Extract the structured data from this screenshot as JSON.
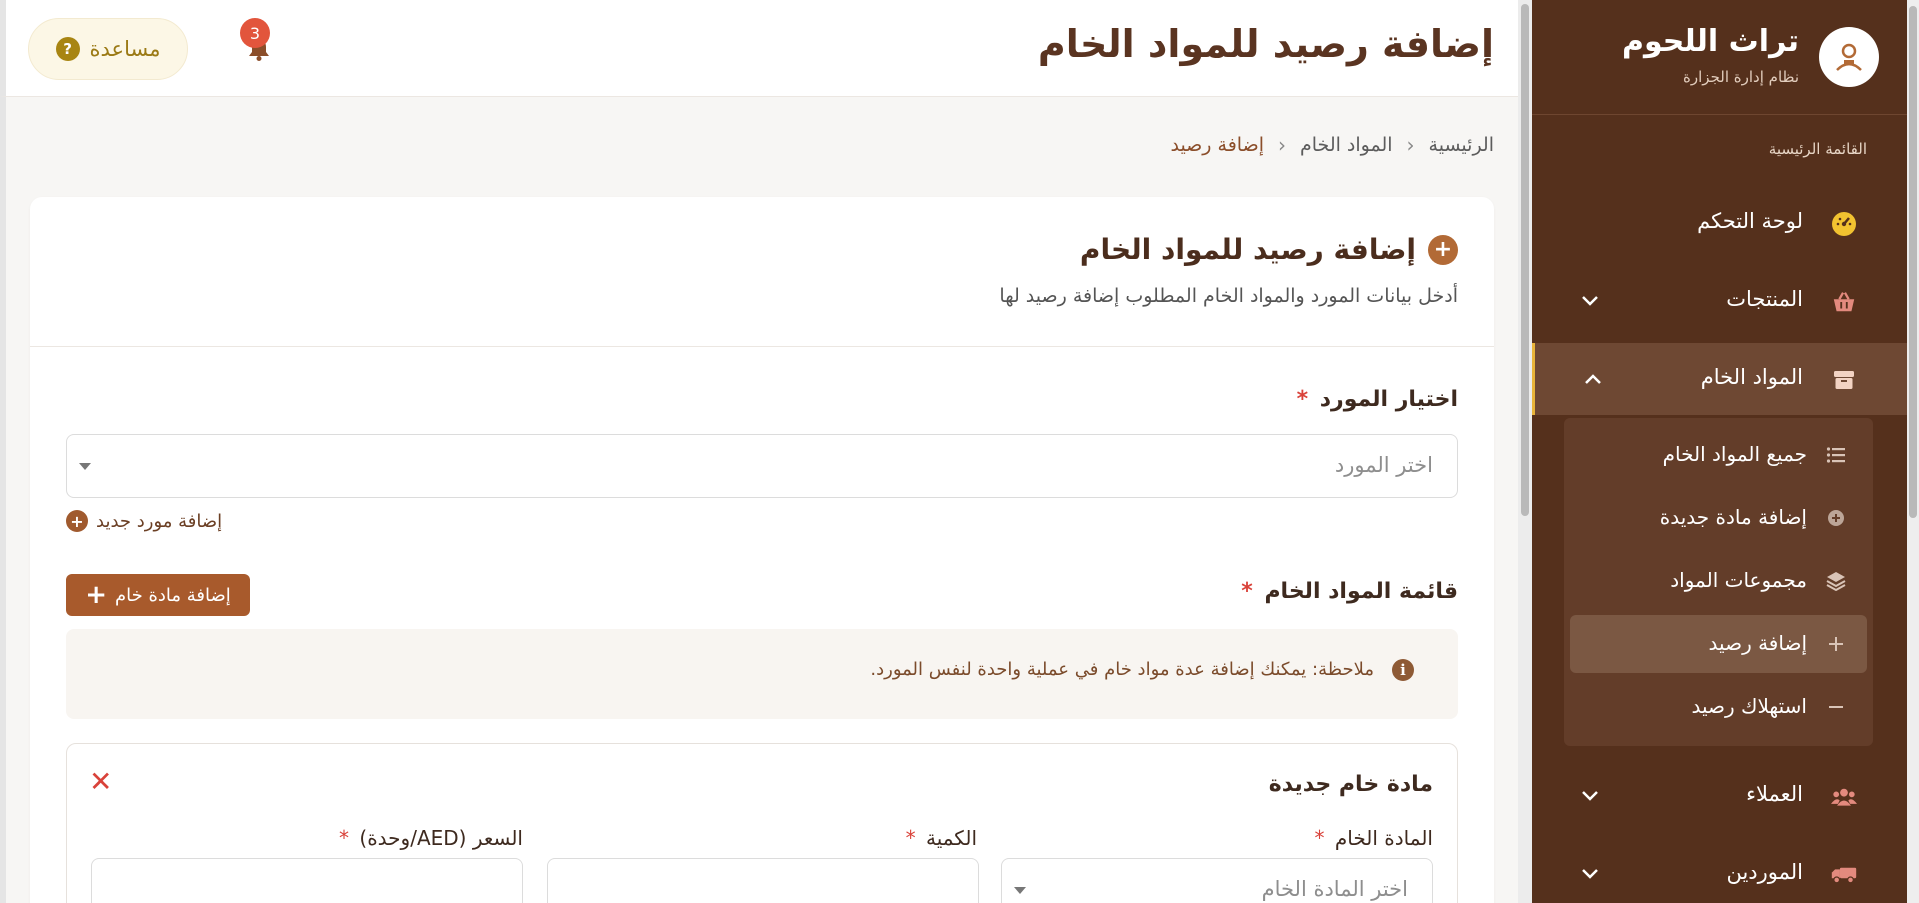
{
  "sidebar": {
    "brand_title": "تراث اللحوم",
    "brand_subtitle": "نظام إدارة الجزارة",
    "section_label": "القائمة الرئيسية",
    "items": [
      {
        "label": "لوحة التحكم",
        "icon": "dashboard-icon"
      },
      {
        "label": "المنتجات",
        "icon": "basket-icon"
      },
      {
        "label": "المواد الخام",
        "icon": "box-icon"
      },
      {
        "label": "العملاء",
        "icon": "users-icon"
      },
      {
        "label": "الموردين",
        "icon": "truck-icon"
      }
    ],
    "submenu": [
      {
        "label": "جميع المواد الخام",
        "icon": "list-icon"
      },
      {
        "label": "إضافة مادة جديدة",
        "icon": "plus-circle-icon"
      },
      {
        "label": "مجموعات المواد",
        "icon": "layers-icon"
      },
      {
        "label": "إضافة رصيد",
        "icon": "plus-icon"
      },
      {
        "label": "استهلاك رصيد",
        "icon": "minus-icon"
      }
    ]
  },
  "topbar": {
    "title": "إضافة رصيد للمواد الخام",
    "help_label": "مساعدة",
    "notification_count": "3"
  },
  "breadcrumb": {
    "home": "الرئيسية",
    "section": "المواد الخام",
    "current": "إضافة رصيد"
  },
  "form": {
    "title": "إضافة رصيد للمواد الخام",
    "description": "أدخل بيانات المورد والمواد الخام المطلوب إضافة رصيد لها",
    "supplier_label": "اختيار المورد",
    "supplier_placeholder": "اختر المورد",
    "add_supplier_link": "إضافة مورد جديد",
    "materials_list_label": "قائمة المواد الخام",
    "add_material_button": "إضافة مادة خام",
    "note": "ملاحظة: يمكنك إضافة عدة مواد خام في عملية واحدة لنفس المورد.",
    "item": {
      "title": "مادة خام جديدة",
      "material_label": "المادة الخام",
      "material_placeholder": "اختر المادة الخام",
      "quantity_label": "الكمية",
      "price_label": "السعر (AED/وحدة)"
    },
    "required_mark": "*"
  },
  "colors": {
    "sidebar_bg": "#55301c",
    "accent": "#a85a2c",
    "active_border": "#e8b43a",
    "required": "#d9423a"
  }
}
